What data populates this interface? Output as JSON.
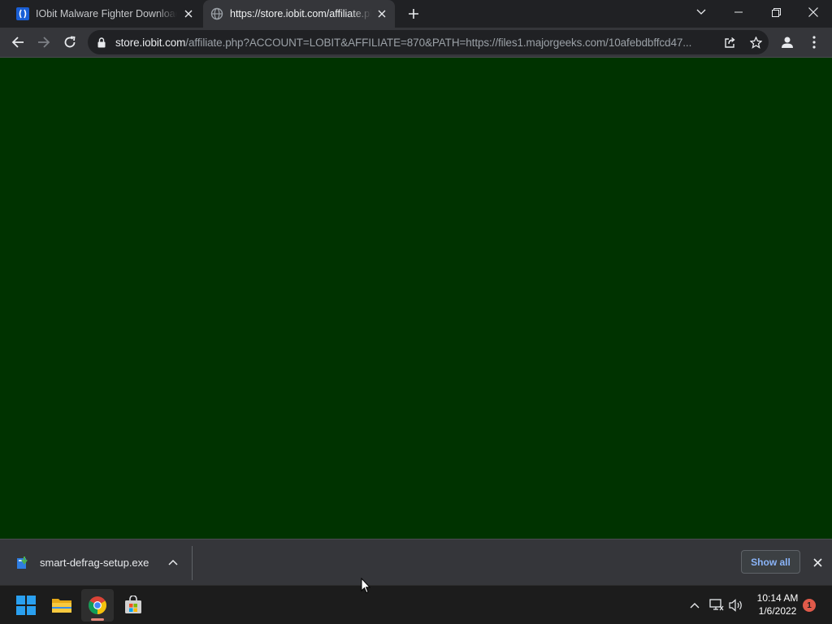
{
  "browser": {
    "tabs": [
      {
        "title": "IObit Malware Fighter Download",
        "favicon": "iobit-favicon",
        "active": false
      },
      {
        "title": "https://store.iobit.com/affiliate.php",
        "favicon": "globe-icon",
        "active": true
      }
    ],
    "new_tab_icon": "plus-icon",
    "window_controls": [
      "tab-search-icon",
      "minimize-icon",
      "restore-icon",
      "close-icon"
    ],
    "omnibox": {
      "domain": "store.iobit.com",
      "path": "/affiliate.php?ACCOUNT=LOBIT&AFFILIATE=870&PATH=https://files1.majorgeeks.com/10afebdbffcd47..."
    }
  },
  "content": {
    "background": "#003300"
  },
  "downloads": {
    "item": {
      "filename": "smart-defrag-setup.exe"
    },
    "show_all_label": "Show all"
  },
  "taskbar": {
    "apps": [
      "windows-start-icon",
      "file-explorer-icon",
      "chrome-icon",
      "microsoft-store-icon"
    ],
    "clock": {
      "time": "10:14 AM",
      "date": "1/6/2022"
    },
    "notification_count": "1"
  },
  "colors": {
    "tab_strip": "#202124",
    "toolbar": "#35363a",
    "accent_link": "#8ab4f8",
    "page_background": "#003300"
  }
}
